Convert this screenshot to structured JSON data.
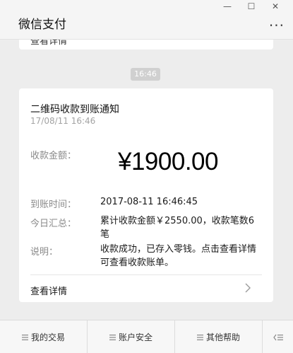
{
  "window": {
    "title": "微信支付",
    "minimize_glyph": "—",
    "maximize_glyph": "☐",
    "close_glyph": "✕",
    "more_glyph": "···"
  },
  "previous_message": {
    "fragment": "查看详情"
  },
  "time_badge": "16:46",
  "notification": {
    "title": "二维码收款到账通知",
    "date": "17/08/11 16:46",
    "amount_label": "收款金额：",
    "amount_value": "¥1900.00",
    "rows": [
      {
        "label": "到账时间：",
        "value": "2017-08-11 16:46:45"
      },
      {
        "label": "今日汇总：",
        "value": "累计收款金额￥2550.00，收款笔数6笔"
      },
      {
        "label": "说明：",
        "value": "收款成功，已存入零钱。点击查看详情可查看收款账单。"
      }
    ],
    "detail_link": "查看详情",
    "detail_icon": "chevron-right-icon"
  },
  "bottom_menu": {
    "tabs": [
      {
        "label": "我的交易",
        "icon": "menu-icon"
      },
      {
        "label": "账户安全",
        "icon": "menu-icon"
      },
      {
        "label": "其他帮助",
        "icon": "menu-icon"
      }
    ],
    "keyboard_toggle_icon": "keyboard-toggle-icon"
  },
  "colors": {
    "background": "#ededed",
    "card": "#ffffff",
    "label_gray": "#8a8a8a",
    "date_gray": "#a3a3a3",
    "badge_gray": "#d0d0d0"
  }
}
